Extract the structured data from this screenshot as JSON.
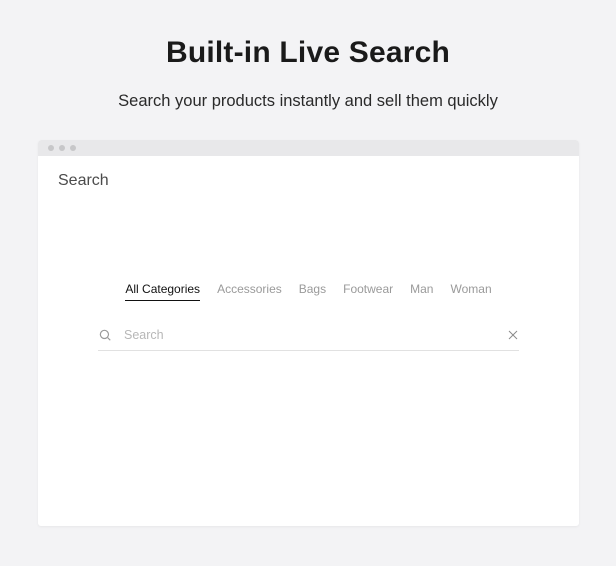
{
  "hero": {
    "title": "Built-in Live Search",
    "subtitle": "Search your products instantly and sell them quickly"
  },
  "window": {
    "title": "Search"
  },
  "tabs": [
    {
      "label": "All Categories",
      "active": true
    },
    {
      "label": "Accessories",
      "active": false
    },
    {
      "label": "Bags",
      "active": false
    },
    {
      "label": "Footwear",
      "active": false
    },
    {
      "label": "Man",
      "active": false
    },
    {
      "label": "Woman",
      "active": false
    }
  ],
  "search": {
    "placeholder": "Search",
    "value": ""
  }
}
